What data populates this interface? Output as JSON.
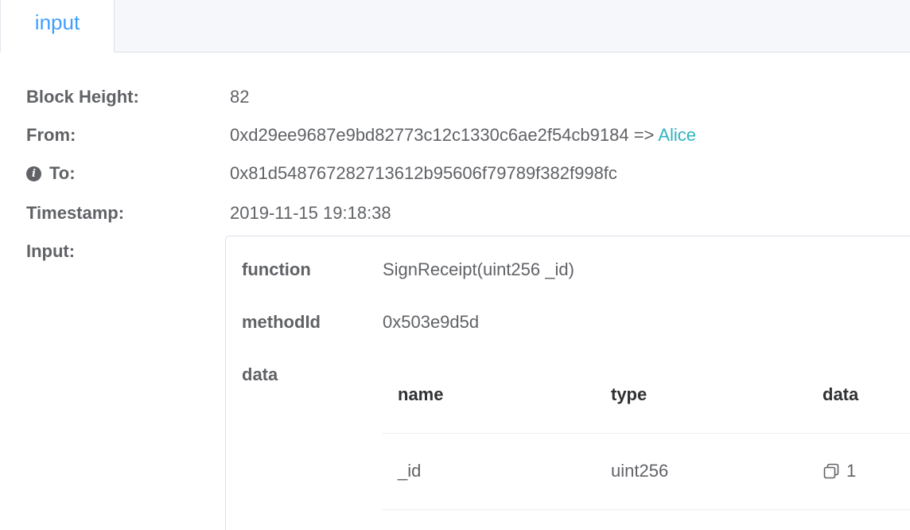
{
  "tabs": [
    {
      "label": "input"
    }
  ],
  "details": {
    "block_height": {
      "label": "Block Height:",
      "value": "82"
    },
    "from": {
      "label": "From:",
      "address": "0xd29ee9687e9bd82773c12c1330c6ae2f54cb9184",
      "arrow": " => ",
      "alias": "Alice"
    },
    "to": {
      "label": "To:",
      "value": "0x81d548767282713612b95606f79789f382f998fc"
    },
    "timestamp": {
      "label": "Timestamp:",
      "value": "2019-11-15 19:18:38"
    },
    "input": {
      "label": "Input:"
    }
  },
  "input_box": {
    "function": {
      "label": "function",
      "value": "SignReceipt(uint256 _id)"
    },
    "method_id": {
      "label": "methodId",
      "value": "0x503e9d5d"
    },
    "data": {
      "label": "data"
    }
  },
  "table": {
    "headers": [
      "name",
      "type",
      "data"
    ],
    "rows": [
      {
        "name": "_id",
        "type": "uint256",
        "data": "1"
      }
    ]
  },
  "icons": {
    "info": "info-circle-icon",
    "copy": "copy-icon"
  },
  "colors": {
    "accent": "#409eff",
    "link": "#2fb4c1"
  }
}
